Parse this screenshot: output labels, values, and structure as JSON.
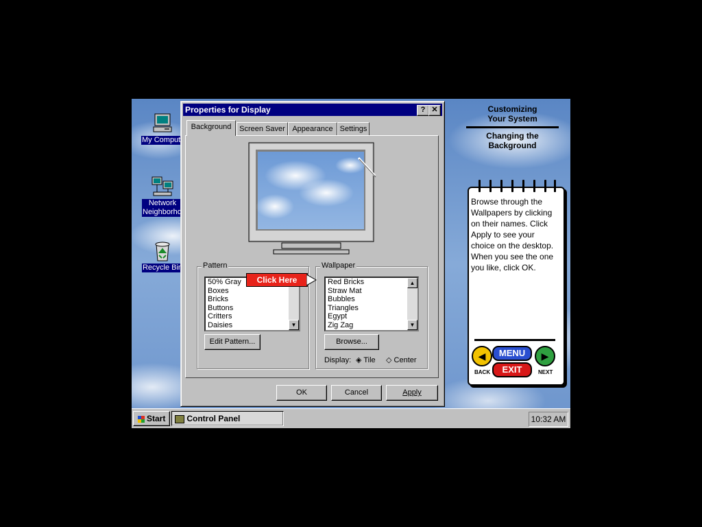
{
  "desktop": {
    "icons": [
      {
        "label": "My Computer",
        "icon": "computer-icon"
      },
      {
        "label": "Network Neighborhood",
        "icon": "network-icon"
      },
      {
        "label": "Recycle Bin",
        "icon": "recycle-bin-icon"
      }
    ]
  },
  "dialog": {
    "title": "Properties for Display",
    "help_btn": "?",
    "close_btn": "✕",
    "tabs": [
      {
        "label": "Background",
        "active": true
      },
      {
        "label": "Screen Saver",
        "active": false
      },
      {
        "label": "Appearance",
        "active": false
      },
      {
        "label": "Settings",
        "active": false
      }
    ],
    "pattern": {
      "label": "Pattern",
      "items": [
        "50% Gray",
        "Boxes",
        "Bricks",
        "Buttons",
        "Critters",
        "Daisies"
      ],
      "edit_button": "Edit Pattern..."
    },
    "wallpaper": {
      "label": "Wallpaper",
      "items": [
        "Red Bricks",
        "Straw Mat",
        "Bubbles",
        "Triangles",
        "Egypt",
        "Zig Zag"
      ],
      "browse_button": "Browse...",
      "display_label": "Display:",
      "options": [
        {
          "label": "Tile",
          "selected": true
        },
        {
          "label": "Center",
          "selected": false
        }
      ]
    },
    "callout": "Click Here",
    "buttons": {
      "ok": "OK",
      "cancel": "Cancel",
      "apply": "Apply"
    }
  },
  "taskbar": {
    "start": "Start",
    "task": "Control Panel",
    "clock": "10:32 AM"
  },
  "help": {
    "section": "Customizing Your System",
    "topic": "Changing the Background",
    "instructions": "Browse through the Wallpapers by clicking on their names.  Click Apply to see your choice on the desktop. When you see the one you like, click OK.",
    "nav": {
      "menu": "MENU",
      "exit": "EXIT",
      "back": "BACK",
      "next": "NEXT"
    }
  },
  "colors": {
    "title_bar": "#000080",
    "callout": "#e8231a",
    "back_button": "#f2c200",
    "next_button": "#2fa040",
    "menu": "#2a4fd0",
    "exit": "#d81818"
  }
}
